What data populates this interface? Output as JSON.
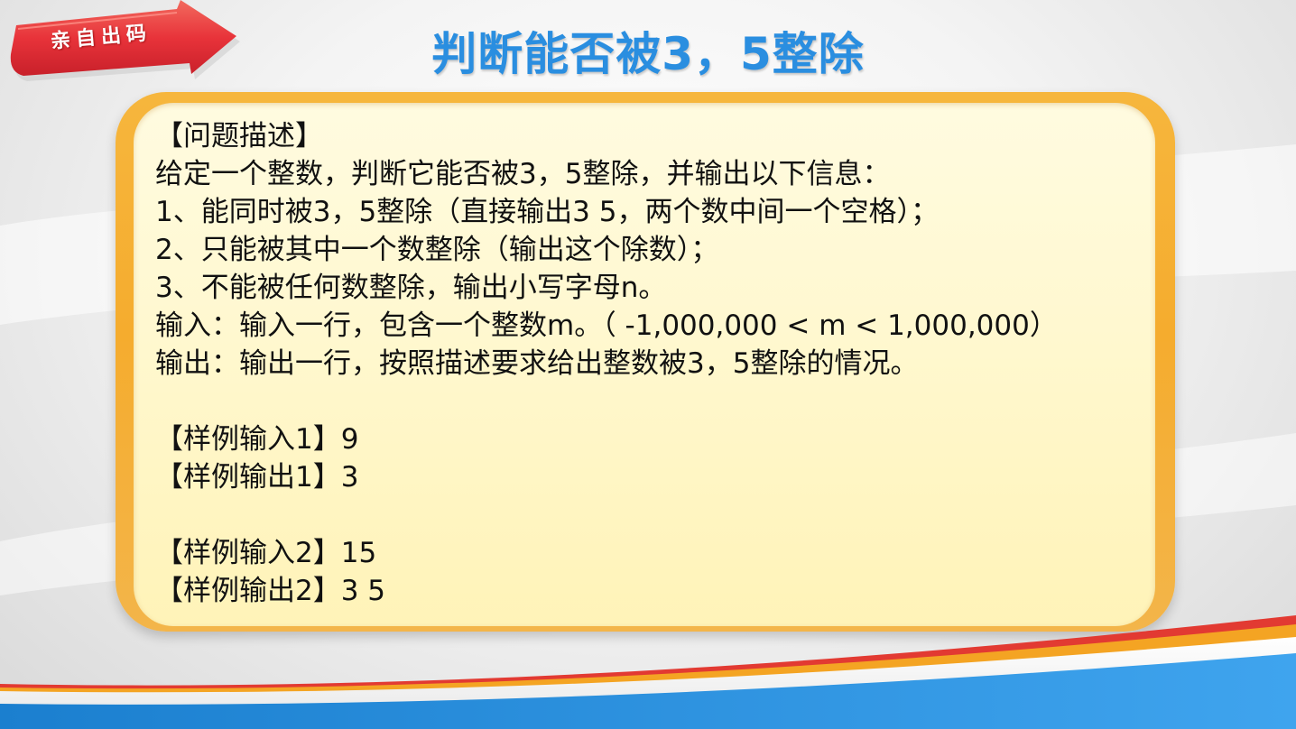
{
  "badge": {
    "text": "亲自出码"
  },
  "title": "判断能否被3，5整除",
  "card": {
    "lines": [
      "【问题描述】",
      "给定一个整数，判断它能否被3，5整除，并输出以下信息：",
      "1、能同时被3，5整除（直接输出3 5，两个数中间一个空格）；",
      "2、只能被其中一个数整除（输出这个除数）；",
      "3、不能被任何数整除，输出小写字母n。",
      "输入：输入一行，包含一个整数m。（ -1,000,000 < m < 1,000,000）",
      "输出：输出一行，按照描述要求给出整数被3，5整除的情况。"
    ],
    "samples": [
      "【样例输入1】9",
      "【样例输出1】3",
      "【样例输入2】15",
      "【样例输出2】3  5"
    ]
  },
  "colors": {
    "title": "#2a8ee0",
    "badge_red": "#e8333a",
    "card_border": "#f5ac2e",
    "card_fill": "#fff8cf",
    "stripe_blue": "#1e86d6",
    "stripe_orange": "#f4a423",
    "stripe_red": "#e23a32"
  }
}
